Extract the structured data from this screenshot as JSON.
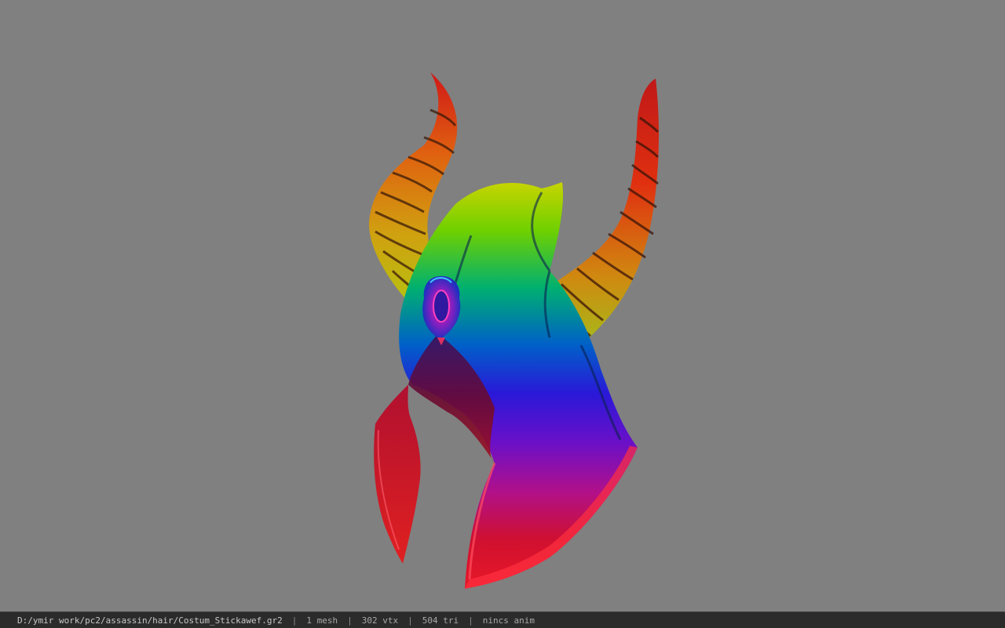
{
  "statusbar": {
    "file_path": "D:/ymir work/pc2/assassin/hair/Costum_Stickawef.gr2",
    "separator": "|",
    "mesh_count": "1 mesh",
    "vertex_count": "302 vtx",
    "triangle_count": "504 tri",
    "animation": "nincs anim"
  },
  "viewport": {
    "background_color": "#808080",
    "model": "horned-hood-helmet"
  }
}
